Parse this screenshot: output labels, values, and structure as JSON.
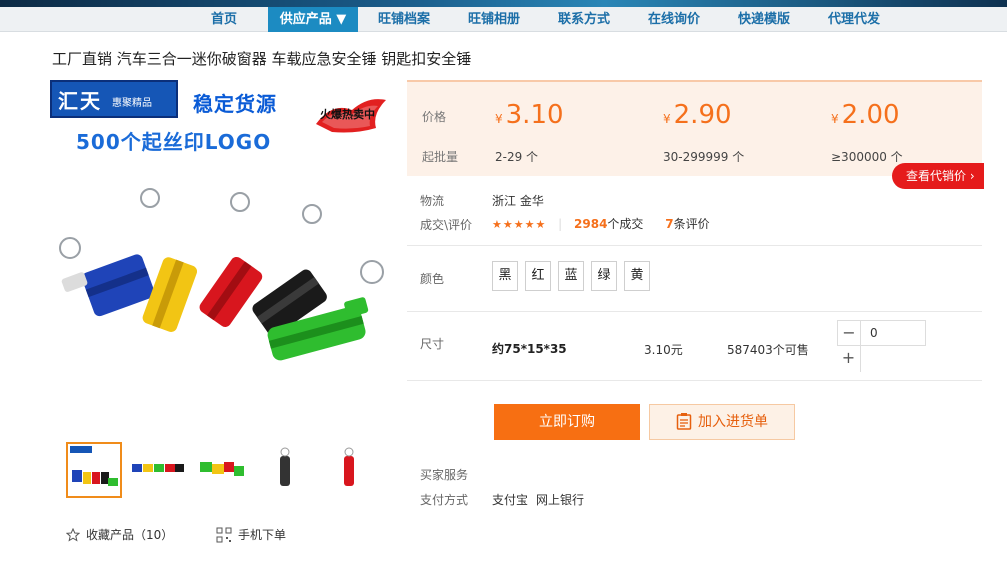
{
  "nav": {
    "items": [
      "首页",
      "供应产品 ▼",
      "旺铺档案",
      "旺铺相册",
      "联系方式",
      "在线询价",
      "快递模版",
      "代理代发"
    ],
    "active_index": 1
  },
  "product": {
    "title": "工厂直销 汽车三合一迷你破窗器 车载应急安全锤 钥匙扣安全锤"
  },
  "main_image": {
    "banner_brand": "汇天",
    "banner_sub": "惠聚精品",
    "banner_stable": "稳定货源",
    "banner_logo": "500个起丝印LOGO",
    "hot_badge": "火爆热卖中"
  },
  "pricing": {
    "price_label": "价格",
    "batch_label": "起批量",
    "currency": "¥",
    "tiers": [
      {
        "price": "3.10",
        "qty": "2-29 个"
      },
      {
        "price": "2.90",
        "qty": "30-299999 个"
      },
      {
        "price": "2.00",
        "qty": "≥300000 个"
      }
    ],
    "agent_button": "查看代销价"
  },
  "logistics": {
    "label": "物流",
    "value": "浙江 金华"
  },
  "reviews": {
    "label": "成交\\评价",
    "stars": "★★★★★",
    "deals_count": "2984",
    "deals_suffix": "个成交",
    "review_count": "7",
    "review_suffix": "条评价"
  },
  "colors": {
    "label": "颜色",
    "options": [
      "黑",
      "红",
      "蓝",
      "绿",
      "黄"
    ]
  },
  "size": {
    "label": "尺寸",
    "value": "约75*15*35",
    "unit_price": "3.10元",
    "stock": "587403个可售",
    "quantity": "0",
    "minus": "−",
    "plus": "+"
  },
  "buttons": {
    "buy": "立即订购",
    "cart": "加入进货单"
  },
  "services": {
    "buyer_label": "买家服务",
    "payment_label": "支付方式",
    "payment_methods": [
      "支付宝",
      "网上银行"
    ]
  },
  "left_actions": {
    "favorite": "收藏产品（10）",
    "mobile_order": "手机下单"
  },
  "colors_theme": {
    "accent": "#f5701c",
    "nav_active": "#1c8bc2",
    "agent_red": "#e51b1b"
  },
  "icons": [
    "star-icon",
    "qr-code-icon",
    "clipboard-icon",
    "chevron-right-icon"
  ]
}
